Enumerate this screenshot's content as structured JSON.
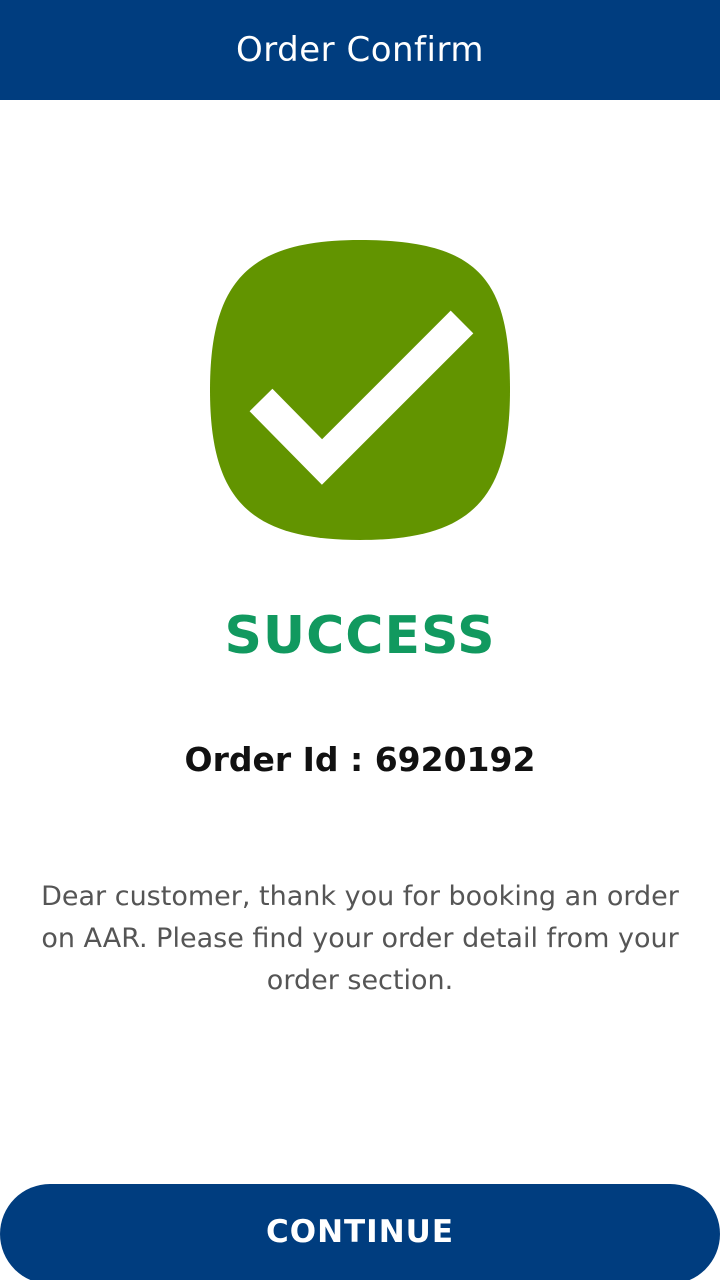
{
  "header": {
    "title": "Order Confirm"
  },
  "status": {
    "icon": "checkmark-circle-icon",
    "icon_color": "#629400",
    "title": "SUCCESS",
    "title_color": "#11995f"
  },
  "order": {
    "id_text": "Order Id : 6920192"
  },
  "message": "Dear customer, thank you for booking an order on AAR. Please find your order detail from your order section.",
  "footer": {
    "continue_label": "CONTINUE",
    "button_color": "#003d7f"
  }
}
